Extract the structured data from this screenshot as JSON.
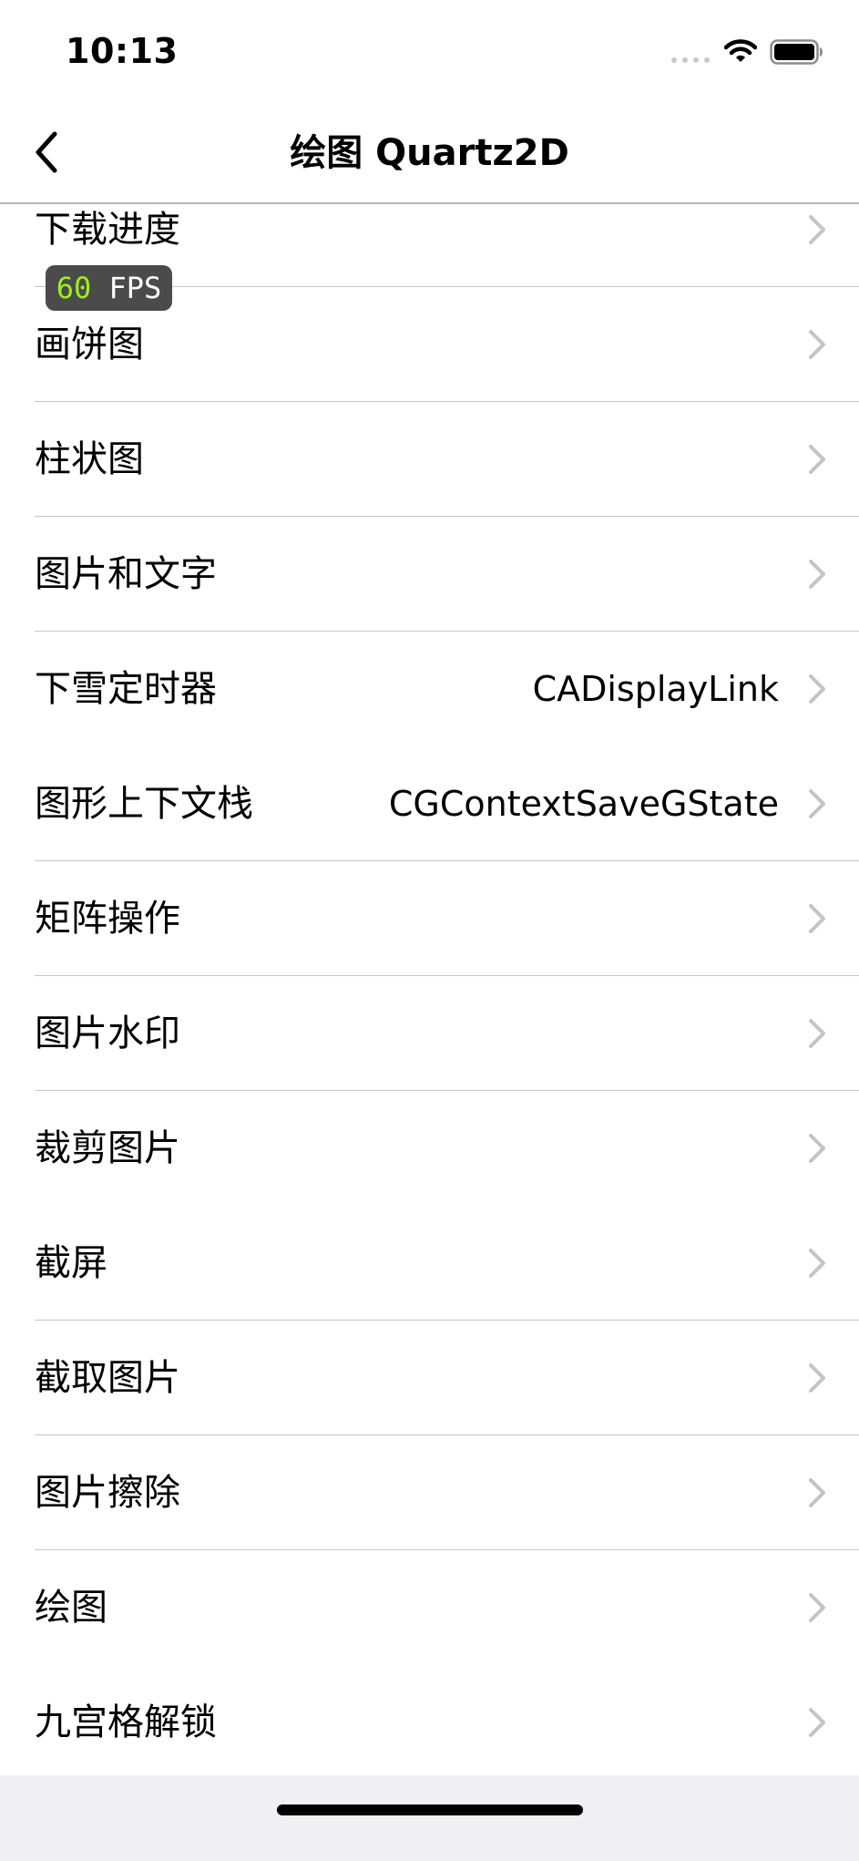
{
  "status_bar": {
    "time": "10:13"
  },
  "nav": {
    "title": "绘图 Quartz2D",
    "back_icon": "chevron-left-icon"
  },
  "fps": {
    "value": "60",
    "unit": " FPS"
  },
  "list": {
    "items": [
      {
        "label": "下载进度",
        "detail": ""
      },
      {
        "label": "画饼图",
        "detail": ""
      },
      {
        "label": "柱状图",
        "detail": ""
      },
      {
        "label": "图片和文字",
        "detail": ""
      },
      {
        "label": "下雪定时器",
        "detail": "CADisplayLink"
      },
      {
        "label": "图形上下文栈",
        "detail": "CGContextSaveGState"
      },
      {
        "label": "矩阵操作",
        "detail": ""
      },
      {
        "label": "图片水印",
        "detail": ""
      },
      {
        "label": "裁剪图片",
        "detail": ""
      },
      {
        "label": "截屏",
        "detail": ""
      },
      {
        "label": "截取图片",
        "detail": ""
      },
      {
        "label": "图片擦除",
        "detail": ""
      },
      {
        "label": "绘图",
        "detail": ""
      },
      {
        "label": "九宫格解锁",
        "detail": ""
      }
    ]
  },
  "colors": {
    "background": "#ffffff",
    "separator": "#c6c6c8",
    "chevron": "#c4c4c7",
    "bottom_background": "#efeff4",
    "fps_badge": "#3c3c3c",
    "fps_value": "#9ef01a"
  }
}
